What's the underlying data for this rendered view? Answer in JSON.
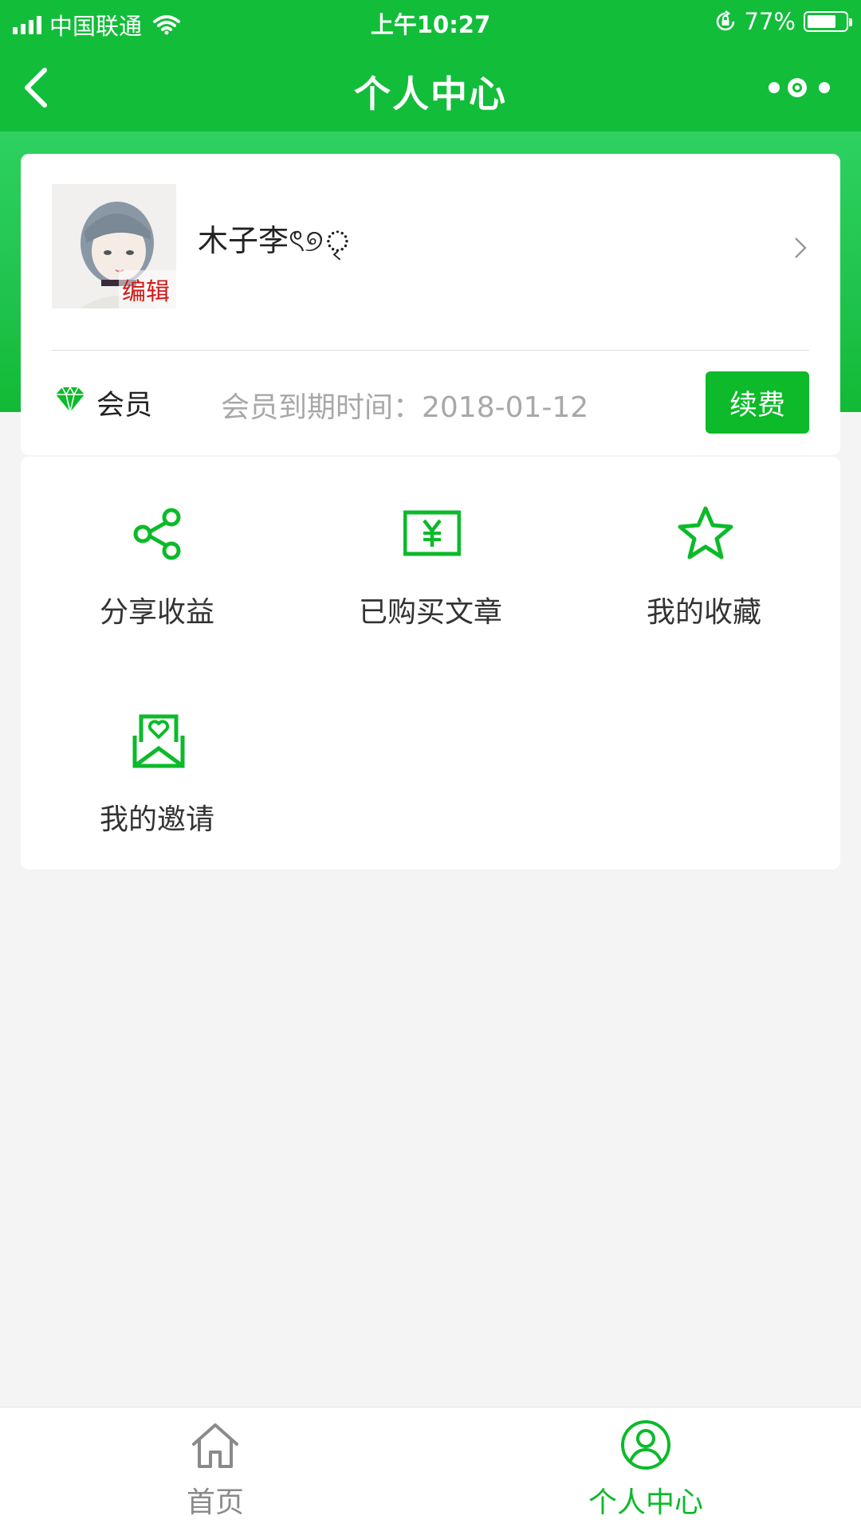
{
  "status_bar": {
    "carrier": "中国联通",
    "time": "上午10:27",
    "battery": "77%",
    "battery_level": 0.77
  },
  "nav": {
    "title": "个人中心",
    "back_icon": "chevron-left-icon",
    "more_icon": "more-dots-icon"
  },
  "profile": {
    "username": "木子李ৎ୭ৃ",
    "edit_label": "编辑",
    "member_label": "会员",
    "expire_text": "会员到期时间：2018-01-12",
    "renew_label": "续费"
  },
  "grid": {
    "items": [
      {
        "label": "分享收益",
        "icon": "share-icon"
      },
      {
        "label": "已购买文章",
        "icon": "yen-bill-icon"
      },
      {
        "label": "我的收藏",
        "icon": "star-icon"
      },
      {
        "label": "我的邀请",
        "icon": "heart-envelope-icon"
      }
    ]
  },
  "tab_bar": {
    "items": [
      {
        "label": "首页",
        "icon": "home-icon",
        "active": false
      },
      {
        "label": "个人中心",
        "icon": "user-circle-icon",
        "active": true
      }
    ]
  },
  "colors": {
    "brand_green": "#12bd3a",
    "button_green": "#0cba2a",
    "edit_red": "#d01a1a"
  }
}
